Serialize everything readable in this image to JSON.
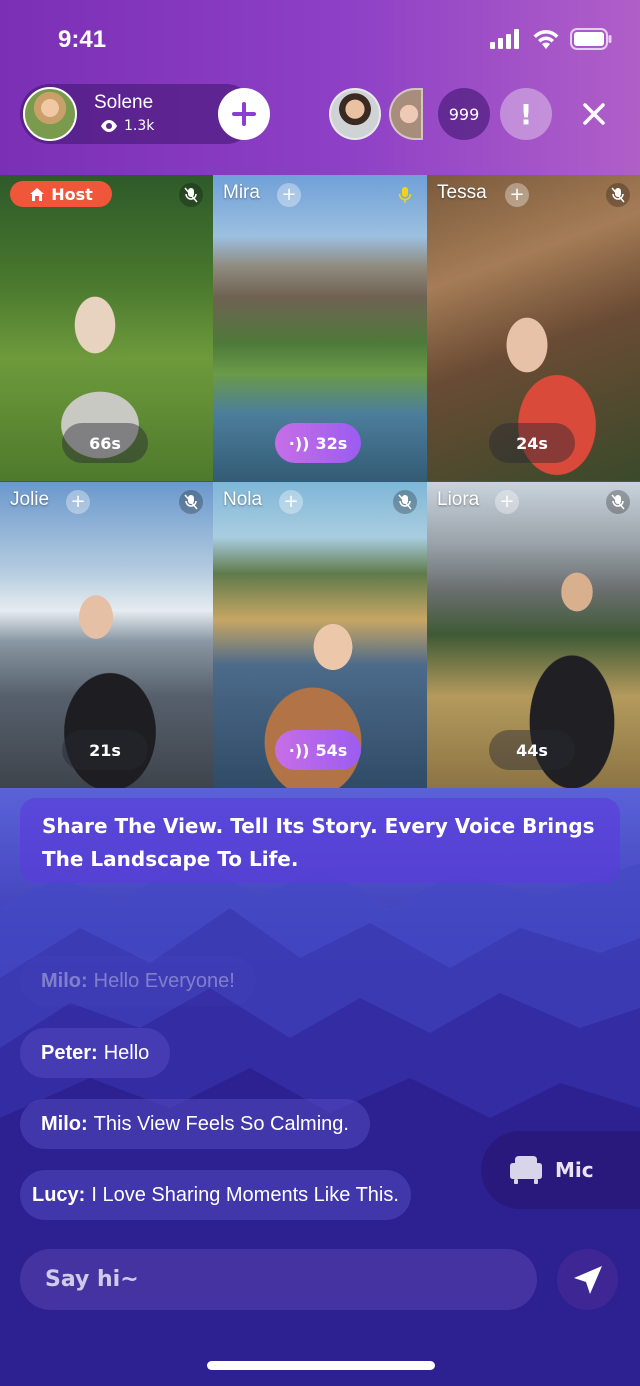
{
  "status_bar": {
    "time": "9:41"
  },
  "host": {
    "name": "Solene",
    "viewers": "1.3k"
  },
  "viewers_count": "999",
  "alert_symbol": "!",
  "tiles": [
    {
      "name": "",
      "host_label": "Host",
      "timer": "66s",
      "speaking": false,
      "muted": true
    },
    {
      "name": "Mira",
      "timer": "32s",
      "speaking": true,
      "muted": false
    },
    {
      "name": "Tessa",
      "timer": "24s",
      "speaking": false,
      "muted": true
    },
    {
      "name": "Jolie",
      "timer": "21s",
      "speaking": false,
      "muted": true
    },
    {
      "name": "Nola",
      "timer": "54s",
      "speaking": true,
      "muted": true
    },
    {
      "name": "Liora",
      "timer": "44s",
      "speaking": false,
      "muted": true
    }
  ],
  "announcement": "Share The View. Tell Its Story. Every Voice Brings The Landscape To Life.",
  "chat": [
    {
      "user": "Milo:",
      "text": "Hello Everyone!"
    },
    {
      "user": "Peter:",
      "text": "Hello"
    },
    {
      "user": "Milo:",
      "text": "This View Feels So Calming."
    },
    {
      "user": "Lucy:",
      "text": "I Love Sharing Moments Like This."
    }
  ],
  "mic_label": "Mic",
  "input_placeholder": "Say hi~",
  "colors": {
    "host_badge": "#f0573a",
    "accent": "#8a3fd0",
    "speaking": "#c76ee6"
  }
}
